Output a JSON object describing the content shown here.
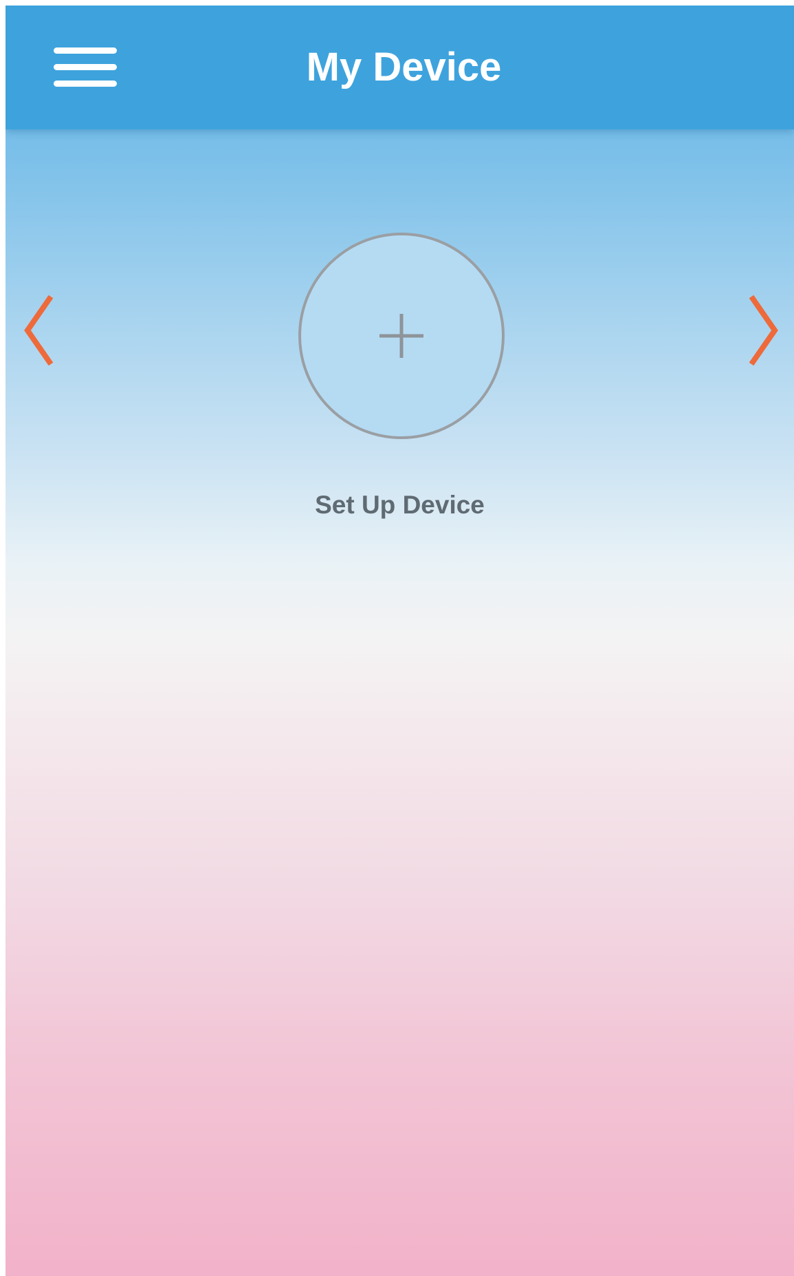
{
  "header": {
    "title": "My Device",
    "menu_icon": "hamburger-menu-icon",
    "background_color": "#3ea3dd"
  },
  "carousel": {
    "prev_icon": "chevron-left-icon",
    "next_icon": "chevron-right-icon",
    "arrow_color": "#ee6a3b"
  },
  "setup": {
    "icon": "plus-icon",
    "label": "Set Up Device"
  }
}
